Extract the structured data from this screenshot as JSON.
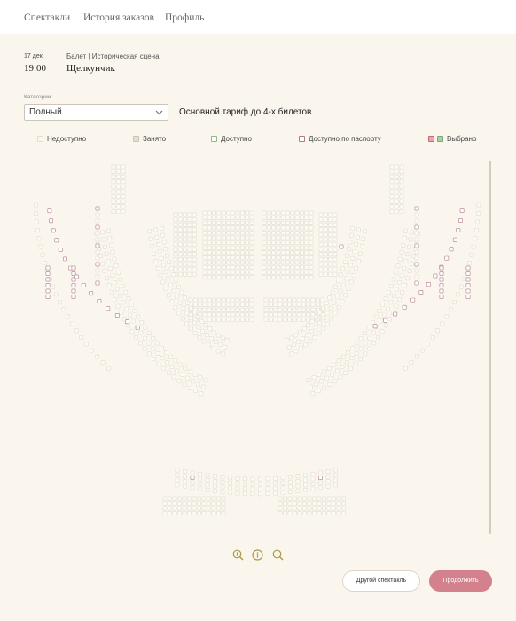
{
  "nav": {
    "items": [
      "Спектакли",
      "История заказов",
      "Профиль"
    ]
  },
  "event": {
    "date": "17 дек.",
    "time": "19:00",
    "meta": "Балет | Историческая сцена",
    "title": "Щелкунчик"
  },
  "category": {
    "label": "Категории",
    "selected": "Полный",
    "tariff_note": "Основной тариф до 4-х билетов"
  },
  "legend": {
    "unavailable": "Недоступно",
    "occupied": "Занято",
    "available": "Доступно",
    "passport": "Доступно по паспорту",
    "selected": "Выбрано"
  },
  "colors": {
    "background": "#faf6ed",
    "seat_unavailable": "#e2ddd1",
    "seat_occupied": "#c9c4b8",
    "seat_available": "#8fb88a",
    "seat_passport": "#b07a88",
    "seat_selected": "#d98a97",
    "accent_button": "#d2818d",
    "zoom_icons": "#a99a47"
  },
  "controls": {
    "zoom_in_icon": "zoom-in-icon",
    "info_icon": "info-icon",
    "zoom_out_icon": "zoom-out-icon"
  },
  "buttons": {
    "other_show": "Другой спектакль",
    "continue": "Продолжить"
  }
}
